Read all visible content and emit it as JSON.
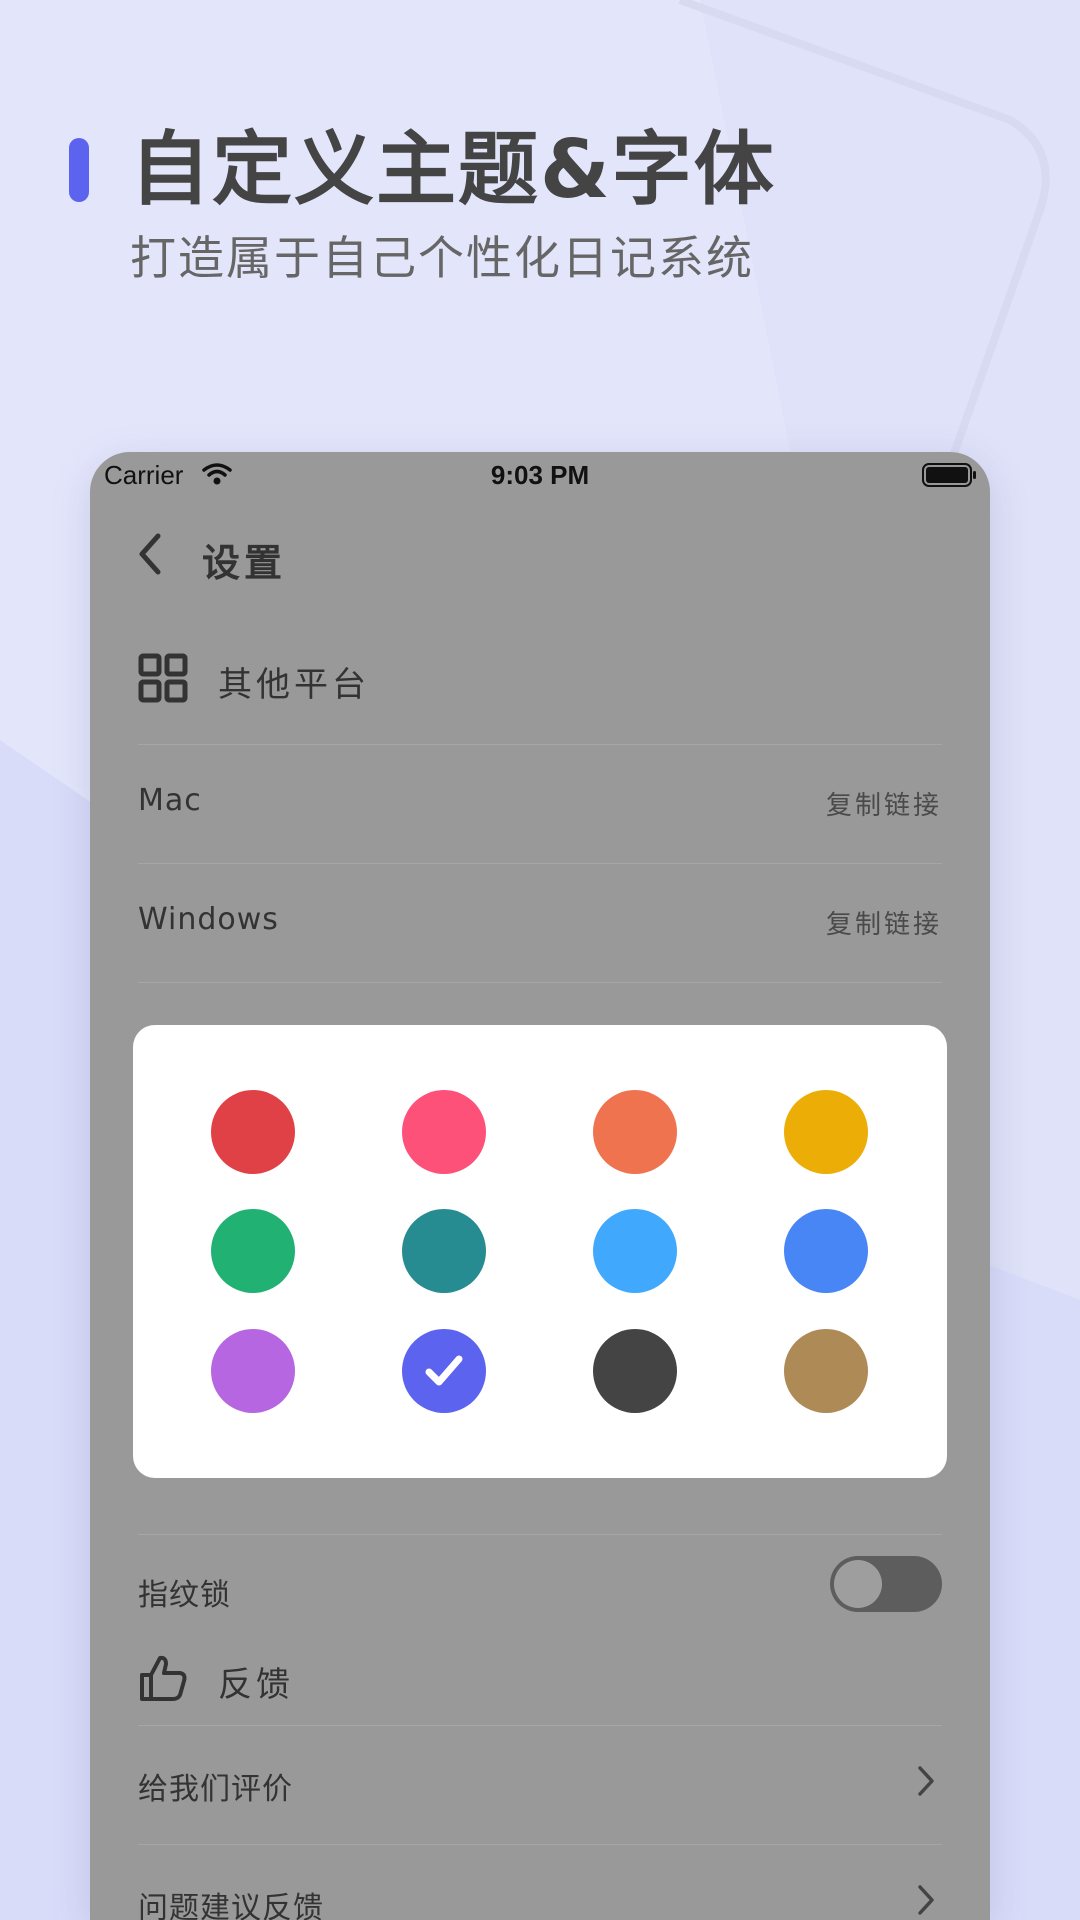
{
  "promo": {
    "title": "自定义主题&字体",
    "subtitle": "打造属于自己个性化日记系统",
    "accent_color": "#5b63ef"
  },
  "status_bar": {
    "carrier": "Carrier",
    "time": "9:03 PM",
    "wifi_icon": "wifi-icon",
    "battery_icon": "battery-icon"
  },
  "nav": {
    "back_icon": "chevron-left-icon",
    "title": "设置"
  },
  "platforms": {
    "icon": "grid-icon",
    "title": "其他平台",
    "rows": [
      {
        "label": "Mac",
        "action": "复制链接"
      },
      {
        "label": "Windows",
        "action": "复制链接"
      }
    ]
  },
  "hidden_row": {
    "label": "指纹锁",
    "toggle_on": false
  },
  "feedback": {
    "icon": "thumbs-up-icon",
    "title": "反馈",
    "rows": [
      {
        "label": "给我们评价"
      },
      {
        "label": "问题建议反馈"
      }
    ]
  },
  "theme_picker": {
    "colors": [
      "#e04146",
      "#fd5179",
      "#f07350",
      "#ecad07",
      "#21b173",
      "#268c91",
      "#41a9fd",
      "#4886f6",
      "#b666e0",
      "#5b63ef",
      "#444444",
      "#ae8a57"
    ],
    "selected_index": 9
  }
}
